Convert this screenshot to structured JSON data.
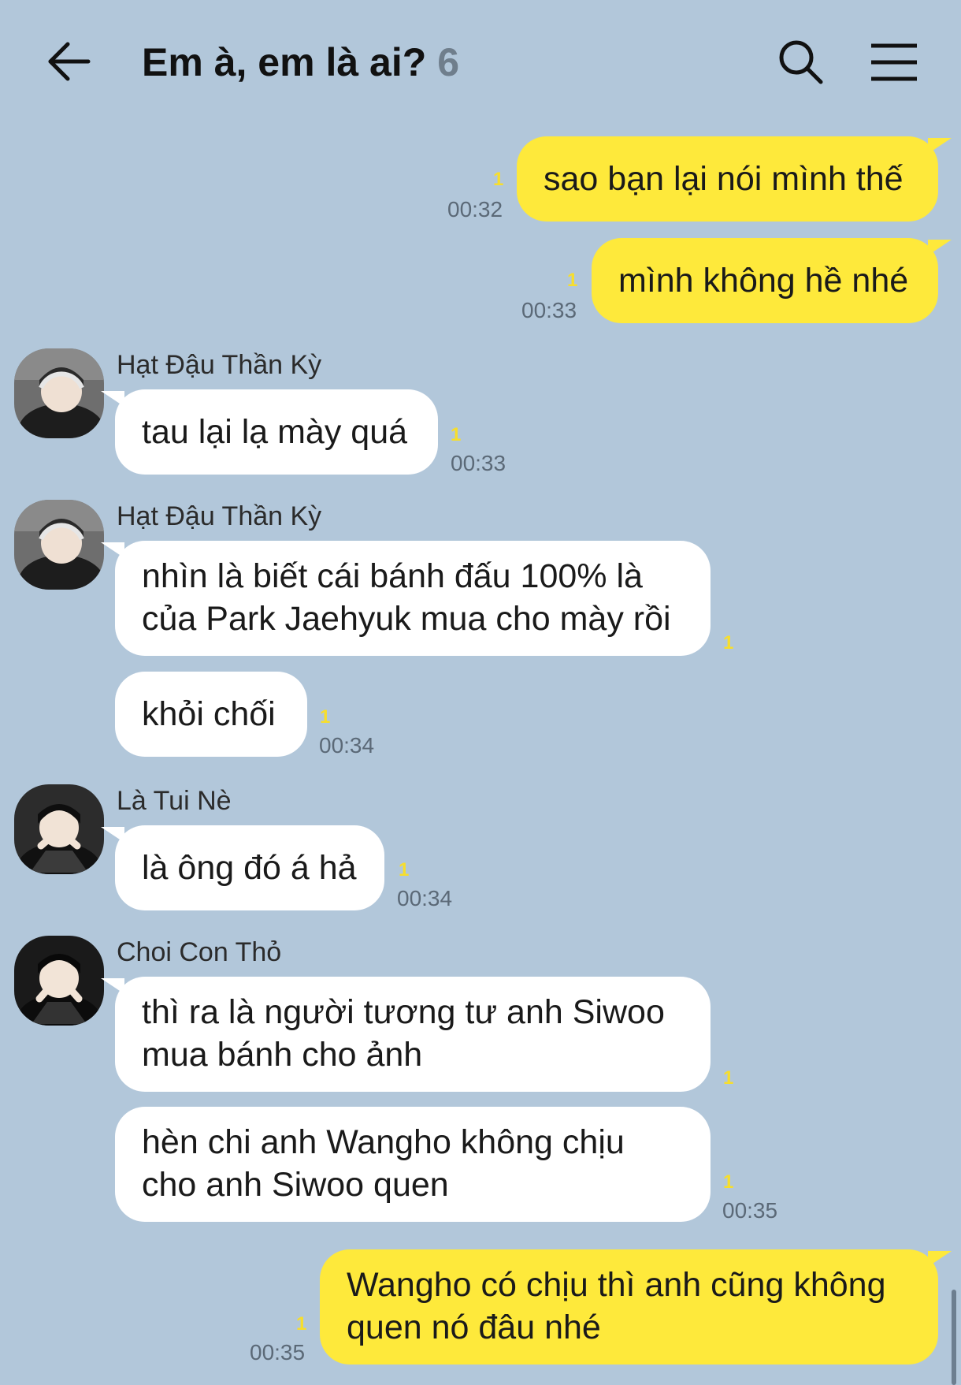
{
  "header": {
    "title": "Em à, em là ai?",
    "member_count": "6",
    "icons": [
      "back-arrow-icon",
      "search-icon",
      "menu-icon"
    ]
  },
  "messages": [
    {
      "side": "me",
      "text": "sao bạn lại nói mình thế",
      "unread": "1",
      "time": "00:32"
    },
    {
      "side": "me",
      "text": "mình không hề nhé",
      "unread": "1",
      "time": "00:33"
    },
    {
      "side": "other",
      "sender": "Hạt Đậu Thần Kỳ",
      "text": "tau lại lạ mày quá",
      "unread": "1",
      "time": "00:33"
    },
    {
      "side": "other",
      "sender": "Hạt Đậu Thần Kỳ",
      "lines": [
        "nhìn là biết cái bánh đấu 100% là",
        "của Park Jaehyuk mua cho mày rồi"
      ],
      "unread": "1"
    },
    {
      "side": "other",
      "text": "khỏi chối",
      "unread": "1",
      "time": "00:34"
    },
    {
      "side": "other",
      "sender": "Là Tui Nè",
      "text": "là ông đó á hả",
      "unread": "1",
      "time": "00:34"
    },
    {
      "side": "other",
      "sender": "Choi Con Thỏ",
      "lines": [
        "thì ra là người tương tư anh Siwoo",
        "mua bánh cho ảnh"
      ],
      "unread": "1"
    },
    {
      "side": "other",
      "lines": [
        "hèn chi anh Wangho không chịu",
        "cho anh Siwoo quen"
      ],
      "unread": "1",
      "time": "00:35"
    },
    {
      "side": "me",
      "lines": [
        "Wangho có chịu thì anh cũng không",
        "quen nó đâu nhé"
      ],
      "unread": "1",
      "time": "00:35"
    }
  ],
  "colors": {
    "background": "#b2c7da",
    "my_bubble": "#fee93b",
    "other_bubble": "#ffffff",
    "unread": "#f7de2c"
  }
}
